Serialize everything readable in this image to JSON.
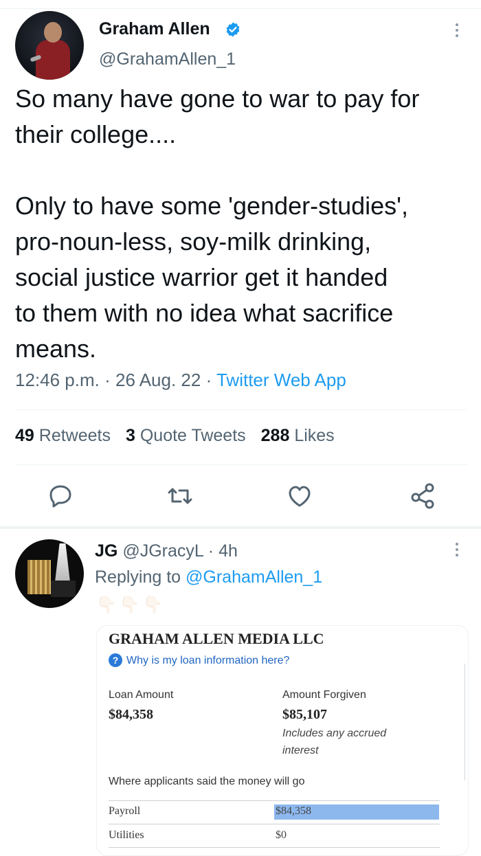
{
  "tweet": {
    "author_name": "Graham Allen",
    "author_handle": "@GrahamAllen_1",
    "text": "So many have gone to war to pay for\ntheir college....\n\nOnly to have some 'gender-studies',\npro-noun-less, soy-milk drinking,\nsocial justice warrior get it handed\nto them with no idea what sacrifice\nmeans.",
    "time": "12:46 p.m.",
    "date": "26 Aug. 22",
    "source": "Twitter Web App",
    "retweets_count": "49",
    "retweets_label": "Retweets",
    "quotes_count": "3",
    "quotes_label": "Quote Tweets",
    "likes_count": "288",
    "likes_label": "Likes"
  },
  "reply": {
    "author_name": "JG",
    "author_handle": "@JGracyL",
    "age": "4h",
    "replying_label": "Replying to",
    "replying_handle": "@GrahamAllen_1",
    "emojis": "👇🏻👇🏻👇🏻",
    "card": {
      "company": "GRAHAM ALLEN MEDIA LLC",
      "why": "Why is my loan information here?",
      "loan_label": "Loan Amount",
      "loan_value": "$84,358",
      "forgiven_label": "Amount Forgiven",
      "forgiven_value": "$85,107",
      "forgiven_note": "Includes any accrued interest",
      "where_label": "Where applicants said the money will go",
      "rows": [
        {
          "label": "Payroll",
          "value": "$84,358",
          "fraction": 1.0
        },
        {
          "label": "Utilities",
          "value": "$0",
          "fraction": 0.0
        }
      ]
    }
  },
  "colors": {
    "accent": "#1d9bf0",
    "muted": "#536471",
    "bar": "#8db8ee"
  },
  "icons": [
    "verified-badge-icon",
    "more-icon",
    "reply-icon",
    "retweet-icon",
    "like-icon",
    "share-icon",
    "help-icon"
  ]
}
